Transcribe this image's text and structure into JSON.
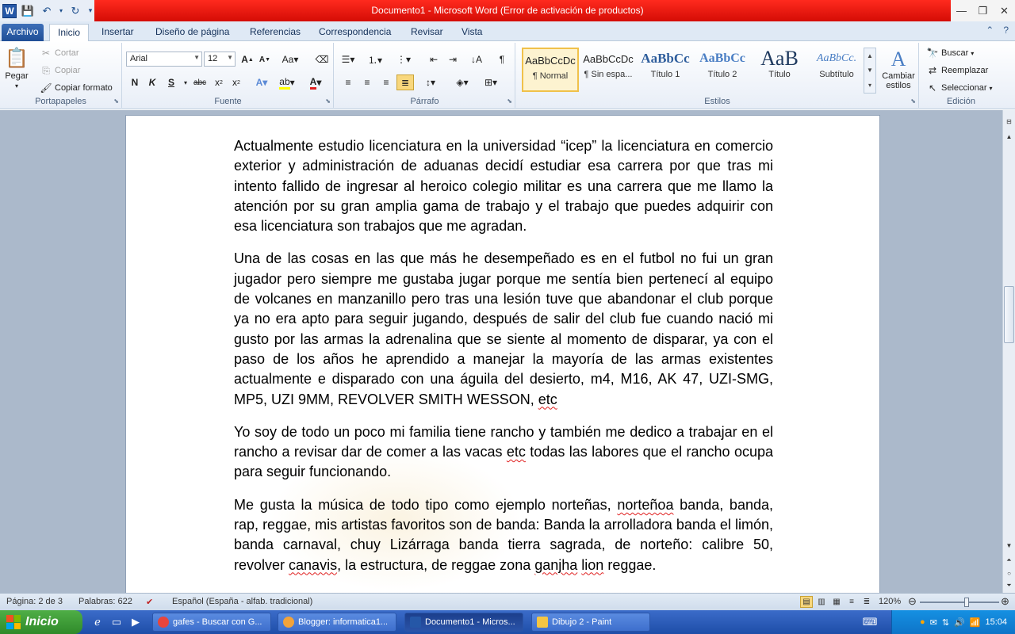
{
  "window": {
    "title": "Documento1  -  Microsoft Word (Error de activación de productos)"
  },
  "tabs": [
    {
      "label": "Archivo"
    },
    {
      "label": "Inicio"
    },
    {
      "label": "Insertar"
    },
    {
      "label": "Diseño de página"
    },
    {
      "label": "Referencias"
    },
    {
      "label": "Correspondencia"
    },
    {
      "label": "Revisar"
    },
    {
      "label": "Vista"
    }
  ],
  "ribbon": {
    "clipboard": {
      "label": "Portapapeles",
      "paste": "Pegar",
      "cut": "Cortar",
      "copy": "Copiar",
      "format_painter": "Copiar formato"
    },
    "font": {
      "label": "Fuente",
      "name": "Arial",
      "size": "12",
      "bold": "N",
      "italic": "K",
      "underline": "S"
    },
    "paragraph": {
      "label": "Párrafo"
    },
    "styles": {
      "label": "Estilos",
      "items": [
        {
          "preview": "AaBbCcDc",
          "name": "¶ Normal"
        },
        {
          "preview": "AaBbCcDc",
          "name": "¶ Sin espa..."
        },
        {
          "preview": "AaBbCc",
          "name": "Título 1"
        },
        {
          "preview": "AaBbCc",
          "name": "Título 2"
        },
        {
          "preview": "AaB",
          "name": "Título"
        },
        {
          "preview": "AaBbCc.",
          "name": "Subtítulo"
        }
      ],
      "change_styles": "Cambiar estilos"
    },
    "editing": {
      "label": "Edición",
      "find": "Buscar",
      "replace": "Reemplazar",
      "select": "Seleccionar"
    }
  },
  "document": {
    "paragraphs": [
      "Actualmente estudio licenciatura en la universidad “icep” la licenciatura en comercio exterior y administración de aduanas decidí estudiar esa carrera por que tras mi intento fallido de ingresar al heroico colegio militar es una carrera que me llamo la atención por su gran amplia gama de trabajo y el trabajo que puedes adquirir con esa licenciatura son trabajos que me agradan.",
      "Una de las cosas en las que más he desempeñado es en el futbol no fui un gran jugador pero siempre me gustaba jugar porque me sentía bien pertenecí al equipo de volcanes en manzanillo pero tras una lesión tuve que abandonar el club porque ya no era apto para seguir jugando, después de salir del club fue cuando nació mi gusto por las armas la adrenalina que se siente al momento de disparar, ya con el paso de los años he aprendido a manejar la mayoría de las armas existentes actualmente e disparado con una águila del desierto, m4, M16, AK 47, UZI-SMG, MP5, UZI 9MM, REVOLVER SMITH WESSON, etc",
      "Yo soy de todo un poco mi familia tiene rancho y también me dedico a trabajar en el rancho a revisar dar de comer a las vacas etc todas las labores que el rancho ocupa para seguir funcionando.",
      "Me gusta la música de todo tipo como ejemplo norteñas, norteñoa banda, banda, rap, reggae, mis artistas favoritos son de banda: Banda la arrolladora banda el limón, banda carnaval, chuy Lizárraga banda tierra sagrada, de norteño: calibre 50, revolver canavis, la estructura, de reggae zona ganjha   lion reggae."
    ]
  },
  "statusbar": {
    "page": "Página: 2 de 3",
    "words": "Palabras: 622",
    "language": "Español (España - alfab. tradicional)",
    "zoom": "120%",
    "zoom_level": 0.6
  },
  "taskbar": {
    "start": "Inicio",
    "tasks": [
      {
        "label": "gafes - Buscar con G...",
        "color": "#e8453c"
      },
      {
        "label": "Blogger: informatica1...",
        "color": "#f2a33a"
      },
      {
        "label": "Documento1 - Micros...",
        "color": "#2557a7"
      },
      {
        "label": "Dibujo 2 - Paint",
        "color": "#f5c542"
      }
    ],
    "clock": "15:04"
  }
}
